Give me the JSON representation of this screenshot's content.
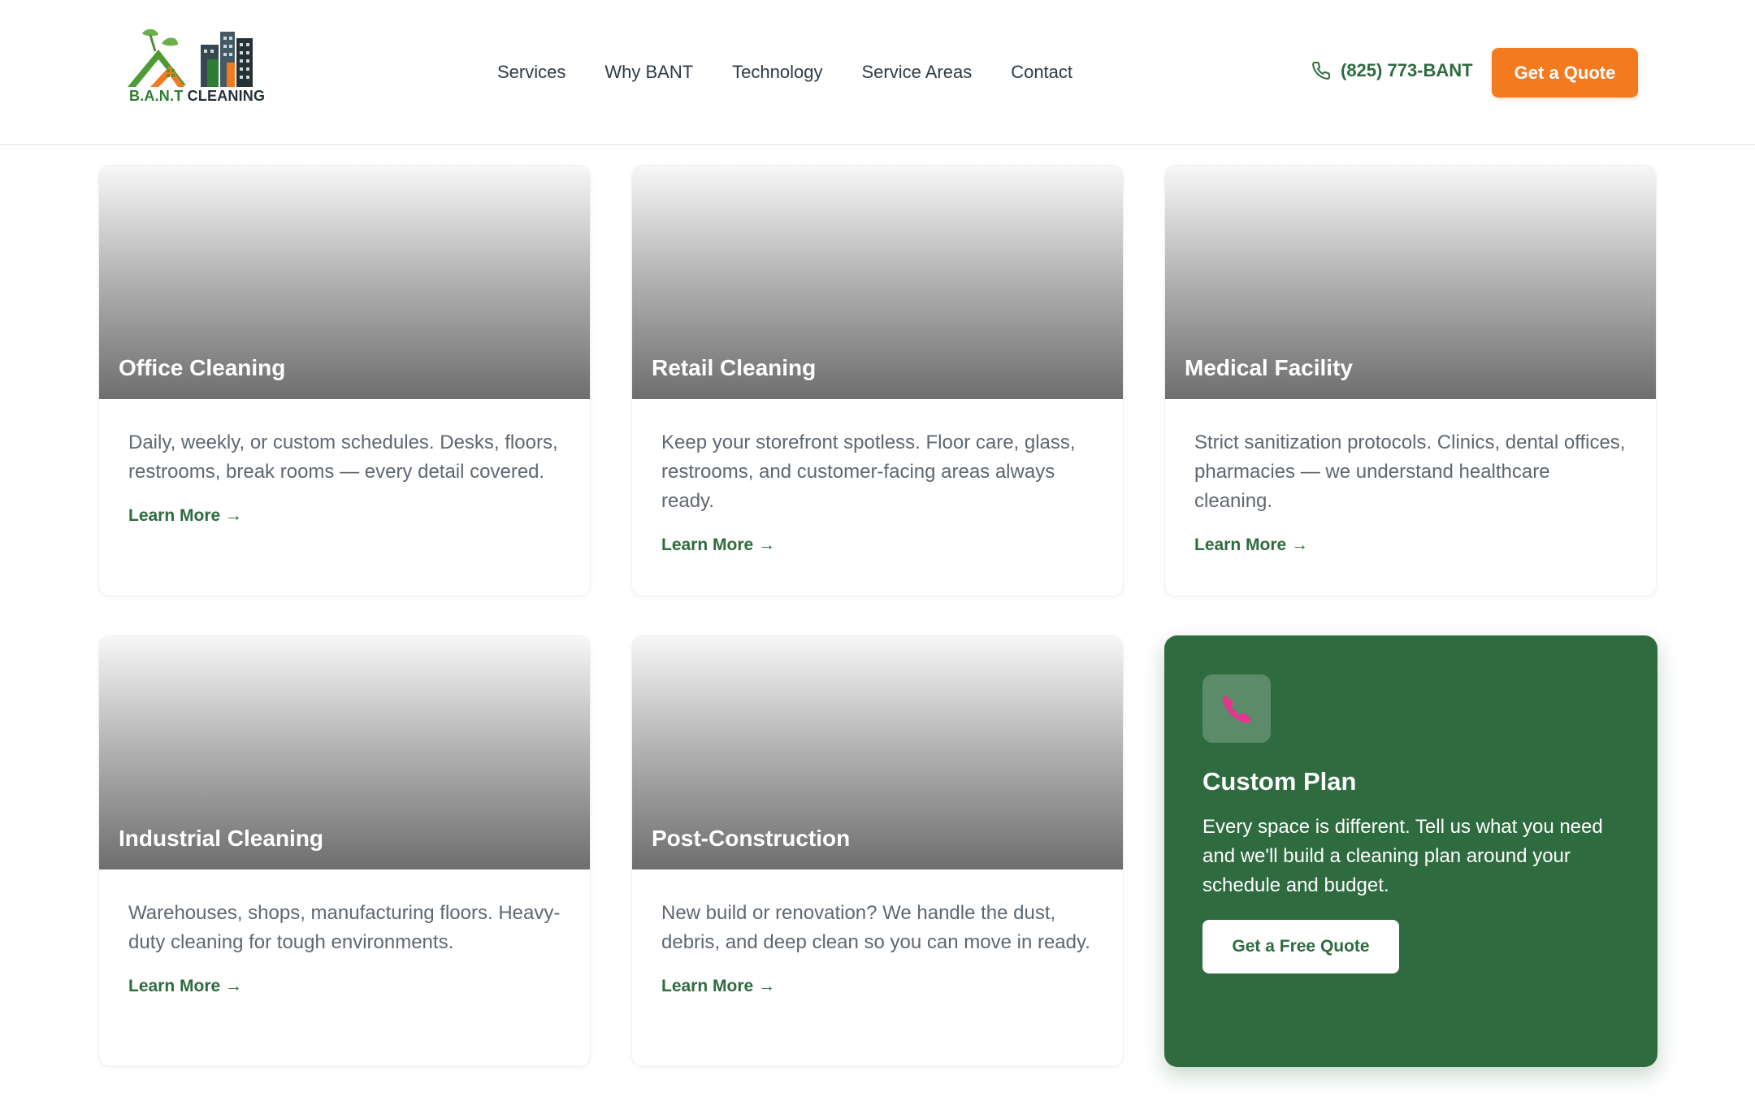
{
  "header": {
    "logo": {
      "brand": "B.A.N.T",
      "suffix": "CLEANING"
    },
    "nav": [
      "Services",
      "Why BANT",
      "Technology",
      "Service Areas",
      "Contact"
    ],
    "phone": "(825) 773-BANT",
    "quote_label": "Get a Quote"
  },
  "cards": [
    {
      "title": "Office Cleaning",
      "description": "Daily, weekly, or custom schedules. Desks, floors, restrooms, break rooms — every detail covered.",
      "link": "Learn More →"
    },
    {
      "title": "Retail Cleaning",
      "description": "Keep your storefront spotless. Floor care, glass, restrooms, and customer-facing areas always ready.",
      "link": "Learn More →"
    },
    {
      "title": "Medical Facility",
      "description": "Strict sanitization protocols. Clinics, dental offices, pharmacies — we understand healthcare cleaning.",
      "link": "Learn More →"
    },
    {
      "title": "Industrial Cleaning",
      "description": "Warehouses, shops, manufacturing floors. Heavy-duty cleaning for tough environments.",
      "link": "Learn More →"
    },
    {
      "title": "Post-Construction",
      "description": "New build or renovation? We handle the dust, debris, and deep clean so you can move in ready.",
      "link": "Learn More →"
    }
  ],
  "cta": {
    "icon": "telephone-receiver-icon",
    "title": "Custom Plan",
    "description": "Every space is different. Tell us what you need and we'll build a cleaning plan around your schedule and budget.",
    "button": "Get a Free Quote"
  },
  "colors": {
    "brand_green": "#2e6b3f",
    "accent_orange": "#f47a20",
    "text_muted": "#5f6770"
  }
}
